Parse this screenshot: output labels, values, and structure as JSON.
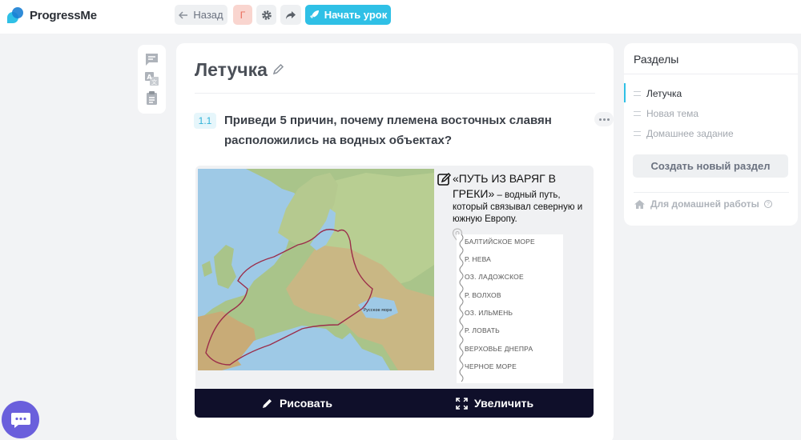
{
  "app": {
    "name": "ProgressMe",
    "brand_color": "#2fc0e6"
  },
  "toolbar": {
    "back_label": "Назад",
    "letter_badge": "Г",
    "start_label": "Начать урок"
  },
  "lesson": {
    "title": "Летучка",
    "task": {
      "number": "1.1",
      "text": "Приведи 5 причин, почему племена восточных славян расположились на водных объектах?"
    },
    "image": {
      "note_title": "«ПУТЬ ИЗ ВАРЯГ В ГРЕКИ»",
      "note_rest": " – водный путь, который связывал северную и южную Европу.",
      "map_label": "Русское море",
      "route": [
        "БАЛТИЙСКОЕ МОРЕ",
        "Р. НЕВА",
        "ОЗ. ЛАДОЖСКОЕ",
        "Р. ВОЛХОВ",
        "ОЗ. ИЛЬМЕНЬ",
        "Р. ЛОВАТЬ",
        "ВЕРХОВЬЕ ДНЕПРА",
        "ЧЕРНОЕ МОРЕ"
      ]
    },
    "media_actions": {
      "draw_label": "Рисовать",
      "zoom_label": "Увеличить"
    }
  },
  "sections": {
    "title": "Разделы",
    "items": [
      {
        "label": "Летучка",
        "active": true
      },
      {
        "label": "Новая тема",
        "active": false
      },
      {
        "label": "Домашнее задание",
        "active": false
      }
    ],
    "create_label": "Создать новый раздел",
    "homework_label": "Для домашней работы",
    "help_mark": "?"
  }
}
